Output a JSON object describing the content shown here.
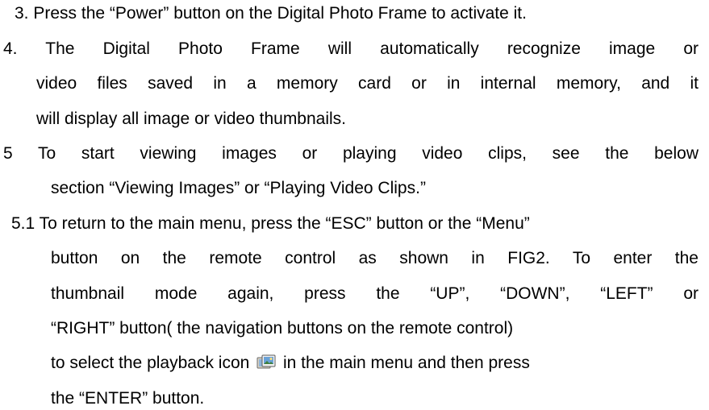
{
  "lines": [
    "3.  Press the “Power” button on the Digital Photo Frame to activate it.",
    "4. The Digital Photo Frame will automatically recognize image or",
    "video files saved in a memory card or in internal memory, and it",
    "will display all image or video thumbnails.",
    "5   To start viewing images or playing video clips, see the below",
    "section “Viewing Images” or “Playing Video Clips.”",
    "5.1 To return to the main menu, press the “ESC” button or the “Menu”",
    "button on the remote control as shown in FIG2. To enter the",
    "thumbnail mode again, press the “UP”, “DOWN”, “LEFT” or",
    "“RIGHT” button( the navigation buttons on the remote control)",
    "the “ENTER” button."
  ],
  "icon_line": {
    "before": "to select the playback icon",
    "after": "in the main menu and then press"
  },
  "icons": {
    "playback": "playback-icon"
  }
}
